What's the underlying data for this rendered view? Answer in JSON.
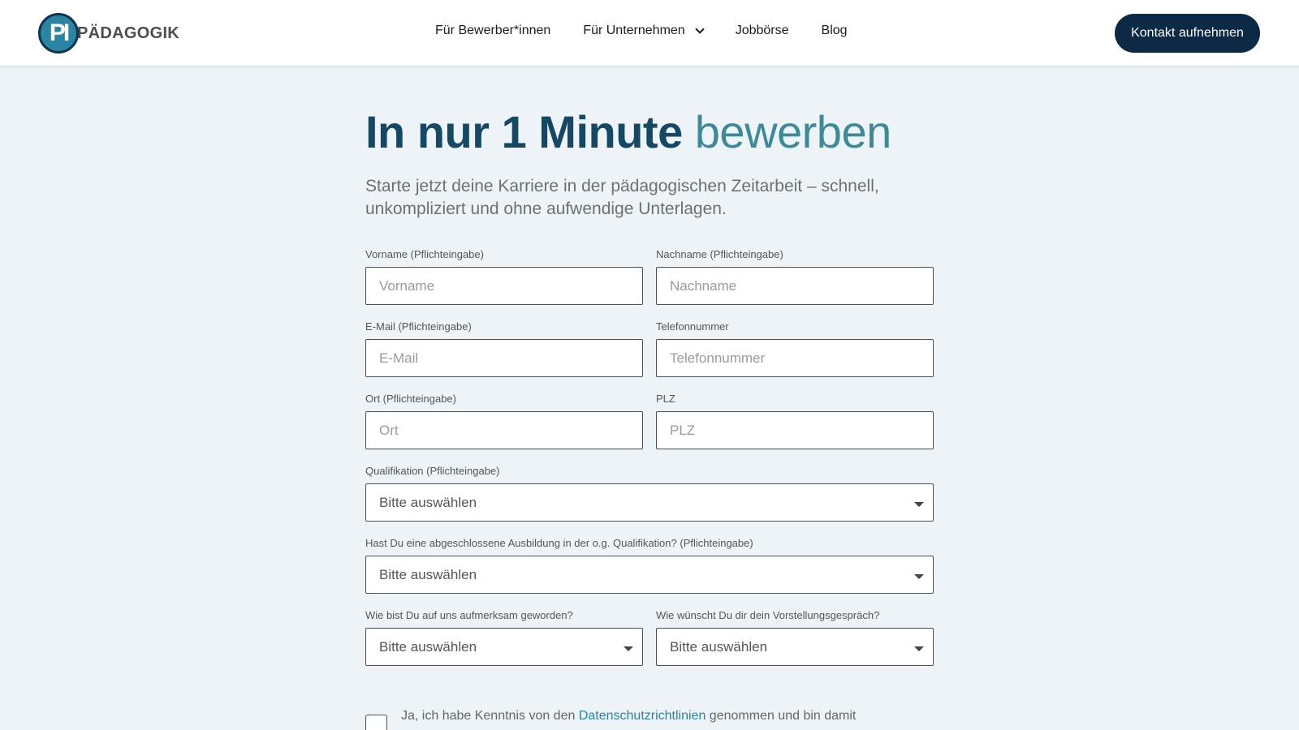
{
  "brand": {
    "logo_text": "PÄDAGOGIK",
    "logo_mark": "PI"
  },
  "nav": {
    "items": [
      {
        "label": "Für Bewerber*innen"
      },
      {
        "label": "Für Unternehmen"
      },
      {
        "label": "Jobbörse"
      },
      {
        "label": "Blog"
      }
    ],
    "cta_label": "Kontakt aufnehmen"
  },
  "hero": {
    "title_bold": "In nur 1 Minute",
    "title_light": "bewerben",
    "subtitle": "Starte jetzt deine Karriere in der pädagogischen Zeitarbeit – schnell, unkompliziert und ohne aufwendige Unterlagen."
  },
  "form": {
    "vorname": {
      "label": "Vorname (Pflichteingabe)",
      "placeholder": "Vorname",
      "value": ""
    },
    "nachname": {
      "label": "Nachname (Pflichteingabe)",
      "placeholder": "Nachname",
      "value": ""
    },
    "email": {
      "label": "E-Mail (Pflichteingabe)",
      "placeholder": "E-Mail",
      "value": ""
    },
    "telefon": {
      "label": "Telefonnummer",
      "placeholder": "Telefonnummer",
      "value": ""
    },
    "ort": {
      "label": "Ort (Pflichteingabe)",
      "placeholder": "Ort",
      "value": ""
    },
    "plz": {
      "label": "PLZ",
      "placeholder": "PLZ",
      "value": ""
    },
    "qualifikation": {
      "label": "Qualifikation (Pflichteingabe)",
      "selected": "Bitte auswählen"
    },
    "ausbildung": {
      "label": "Hast Du eine abgeschlossene Ausbildung in der o.g. Qualifikation? (Pflichteingabe)",
      "selected": "Bitte auswählen"
    },
    "aufmerksam": {
      "label": "Wie bist Du auf uns aufmerksam geworden?",
      "selected": "Bitte auswählen"
    },
    "gespraech": {
      "label": "Wie wünscht Du dir dein Vorstellungsgespräch?",
      "selected": "Bitte auswählen"
    },
    "consent": {
      "text_before": "Ja, ich habe Kenntnis von den ",
      "link": "Datenschutzrichtlinien",
      "text_after": " genommen und bin damit"
    }
  },
  "icons": {
    "nav_dropdown": "chevron-down-icon",
    "select_caret": "caret-down-icon"
  }
}
